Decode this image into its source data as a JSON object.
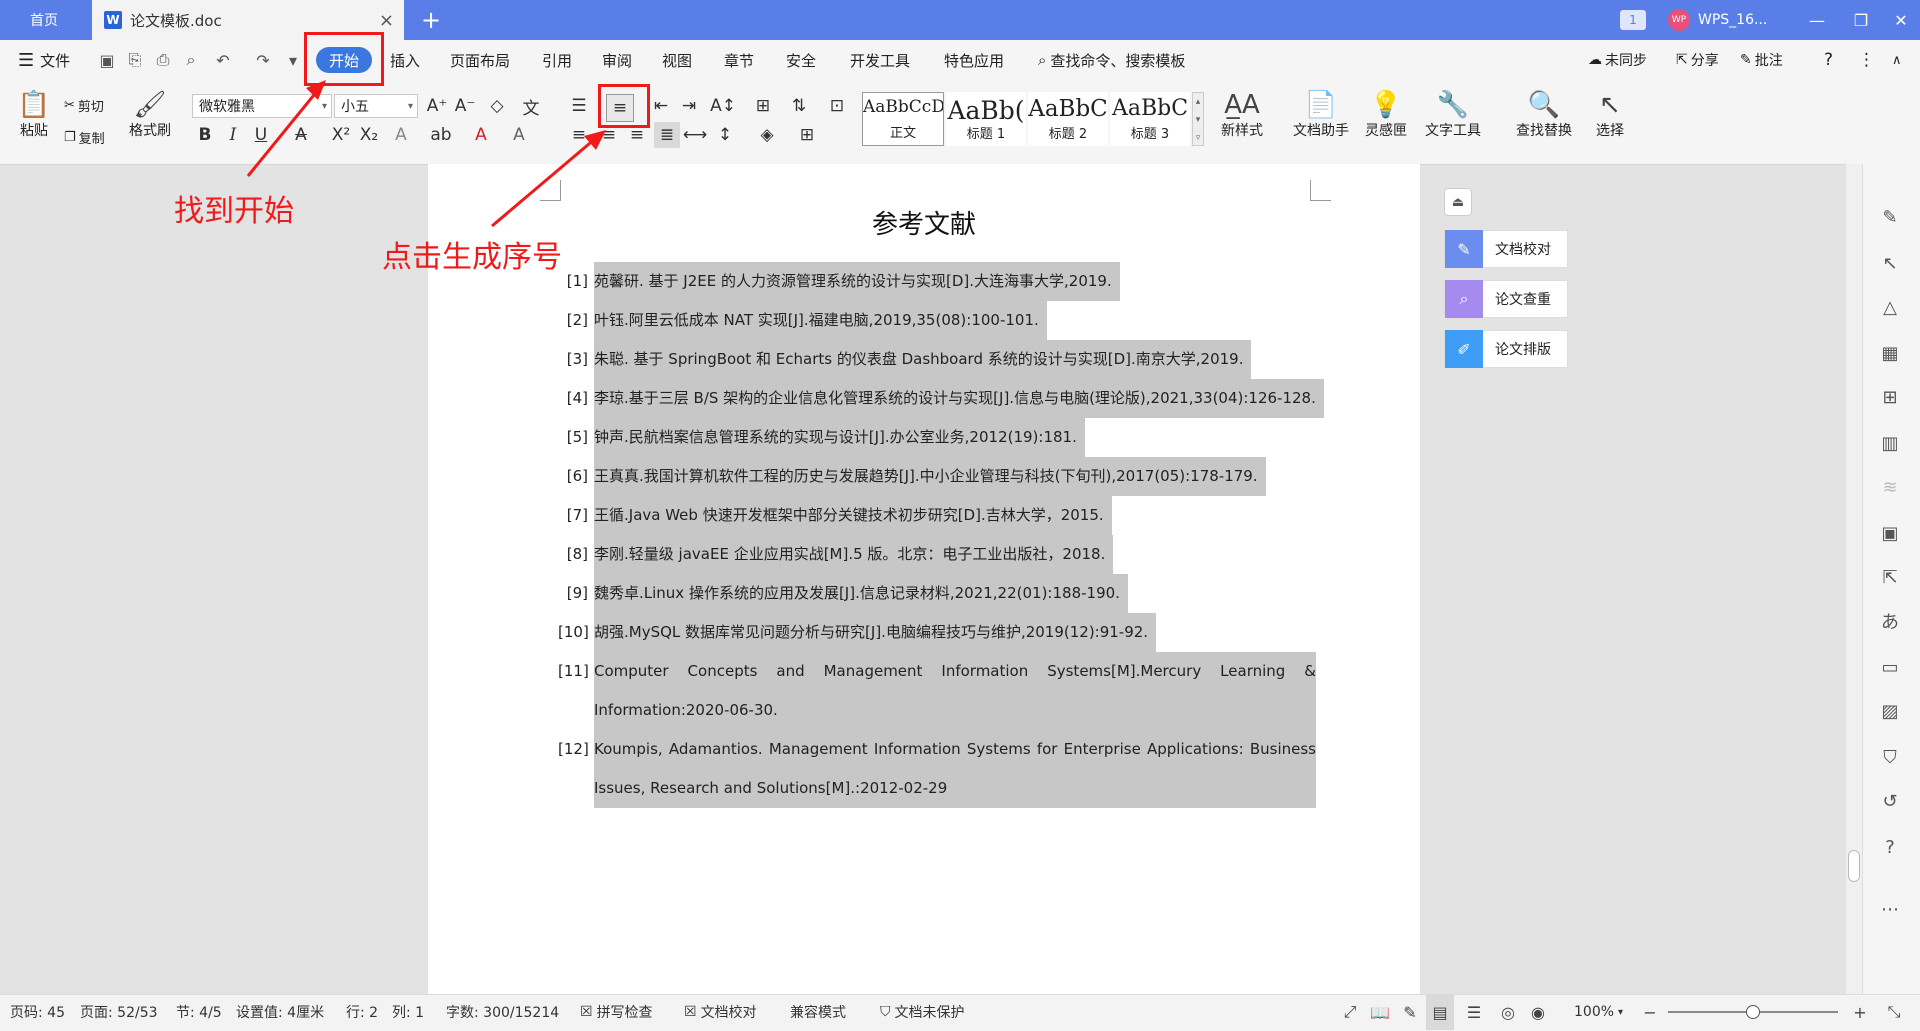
{
  "titlebar": {
    "home_tab": "首页",
    "doc_tab": "论文模板.doc",
    "doc_icon": "W",
    "new_tab": "+",
    "badge": "1",
    "user_avatar": "WP",
    "user": "WPS_16..."
  },
  "menubar": {
    "file": "文件",
    "items": [
      "开始",
      "插入",
      "页面布局",
      "引用",
      "审阅",
      "视图",
      "章节",
      "安全",
      "开发工具",
      "特色应用"
    ],
    "search": "查找命令、搜索模板",
    "sync": "未同步",
    "share": "分享",
    "comment": "批注"
  },
  "ribbon": {
    "paste": "粘贴",
    "cut": "剪切",
    "copy": "复制",
    "format_painter": "格式刷",
    "font_name": "微软雅黑",
    "font_size": "小五",
    "styles": [
      {
        "sample": "AaBbCcDd",
        "label": "正文"
      },
      {
        "sample": "AaBb(",
        "label": "标题 1"
      },
      {
        "sample": "AaBbC",
        "label": "标题 2"
      },
      {
        "sample": "AaBbC",
        "label": "标题 3"
      }
    ],
    "new_style": "新样式",
    "doc_assistant": "文档助手",
    "inspiration": "灵感匣",
    "text_tools": "文字工具",
    "find_replace": "查找替换",
    "select": "选择"
  },
  "document": {
    "title": "参考文献",
    "references": [
      {
        "num": "[1]",
        "lines": [
          "苑馨研. 基于 J2EE 的人力资源管理系统的设计与实现[D].大连海事大学,2019."
        ]
      },
      {
        "num": "[2]",
        "lines": [
          "叶钰.阿里云低成本 NAT 实现[J].福建电脑,2019,35(08):100-101."
        ]
      },
      {
        "num": "[3]",
        "lines": [
          "朱聪. 基于 SpringBoot 和 Echarts 的仪表盘 Dashboard 系统的设计与实现[D].南京大学,2019."
        ]
      },
      {
        "num": "[4]",
        "lines": [
          "李琼.基于三层 B/S 架构的企业信息化管理系统的设计与实现[J].信息与电脑(理论版),2021,33(04):126-128."
        ]
      },
      {
        "num": "[5]",
        "lines": [
          "钟声.民航档案信息管理系统的实现与设计[J].办公室业务,2012(19):181."
        ]
      },
      {
        "num": "[6]",
        "lines": [
          "王真真.我国计算机软件工程的历史与发展趋势[J].中小企业管理与科技(下旬刊),2017(05):178-179."
        ]
      },
      {
        "num": "[7]",
        "lines": [
          "王循.Java Web 快速开发框架中部分关键技术初步研究[D].吉林大学，2015."
        ]
      },
      {
        "num": "[8]",
        "lines": [
          "李刚.轻量级 javaEE 企业应用实战[M].5 版。北京：电子工业出版社，2018."
        ]
      },
      {
        "num": "[9]",
        "lines": [
          "魏秀卓.Linux 操作系统的应用及发展[J].信息记录材料,2021,22(01):188-190."
        ]
      },
      {
        "num": "[10]",
        "lines": [
          "胡强.MySQL 数据库常见问题分析与研究[J].电脑编程技巧与维护,2019(12):91-92."
        ]
      },
      {
        "num": "[11]",
        "lines": [
          "Computer Concepts and Management Information Systems[M].Mercury Learning &",
          "Information:2020-06-30."
        ]
      },
      {
        "num": "[12]",
        "lines": [
          "Koumpis, Adamantios. Management Information Systems for Enterprise Applications: Business",
          "Issues, Research and Solutions[M].:2012-02-29"
        ]
      }
    ]
  },
  "side_panel": [
    {
      "label": "文档校对",
      "color": "#6b8df0"
    },
    {
      "label": "论文查重",
      "color": "#a58af0"
    },
    {
      "label": "论文排版",
      "color": "#3e9ef5"
    }
  ],
  "statusbar": {
    "page_code": "页码: 45",
    "page": "页面: 52/53",
    "section": "节: 4/5",
    "setting": "设置值: 4厘米",
    "row": "行: 2",
    "col": "列: 1",
    "words": "字数: 300/15214",
    "spell": "拼写检查",
    "proof": "文档校对",
    "compat": "兼容模式",
    "protect": "文档未保护",
    "zoom": "100%"
  },
  "annotations": {
    "find_start": "找到开始",
    "click_numbering": "点击生成序号"
  },
  "colors": {
    "titlebar": "#5a7ee8",
    "start_button": "#3a78e0",
    "annotation": "#f01a1a",
    "selection": "#c7c7c7"
  }
}
